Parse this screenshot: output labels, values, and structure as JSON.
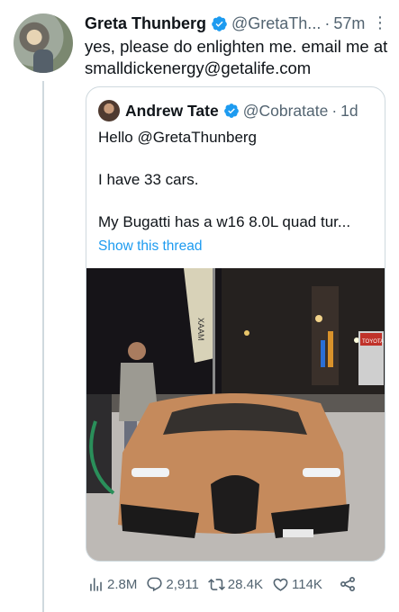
{
  "tweet": {
    "author_name": "Greta Thunberg",
    "author_handle": "@GretaTh...",
    "separator": "·",
    "time": "57m",
    "more_label": "⋮",
    "text": "yes, please do enlighten me. email me at smalldickenergy@getalife.com"
  },
  "quote": {
    "author_name": "Andrew Tate",
    "author_handle": "@Cobratate",
    "separator": "·",
    "time": "1d",
    "line1": "Hello @GretaThunberg",
    "line2": "I have 33 cars.",
    "line3": "My Bugatti has a w16 8.0L quad tur...",
    "show_thread": "Show this thread",
    "photo_sign": "XAAM",
    "plate": "TOYOTA"
  },
  "actions": {
    "views": "2.8M",
    "replies": "2,911",
    "retweets": "28.4K",
    "likes": "114K"
  },
  "colors": {
    "accent": "#1d9bf0",
    "secondary_text": "#536471",
    "border": "#cfd9de"
  }
}
